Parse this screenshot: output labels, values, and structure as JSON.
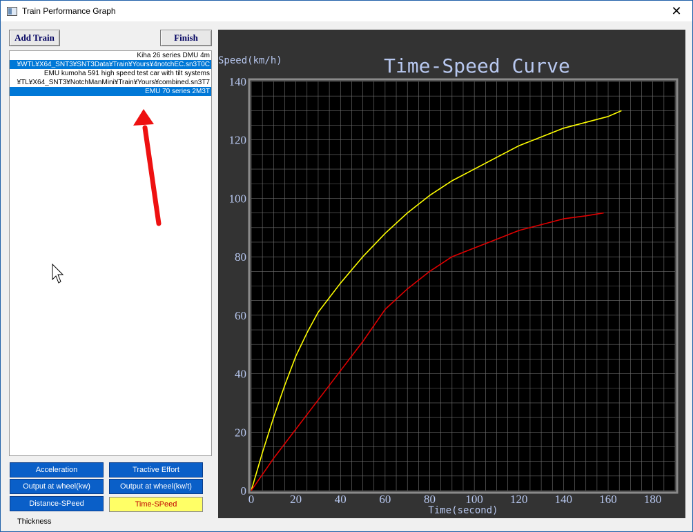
{
  "window": {
    "title": "Train Performance Graph",
    "close_symbol": "✕"
  },
  "toolbar": {
    "add_train": "Add Train",
    "finish": "Finish"
  },
  "train_list": [
    {
      "label": "Kiha 26 series DMU 4m",
      "selected": false
    },
    {
      "label": "¥WTL¥X64_SNT3¥SNT3Data¥Train¥Yours¥4notchEC.sn3T0C",
      "selected": true
    },
    {
      "label": "EMU kumoha 591 high speed test car with tilt systems",
      "selected": false
    },
    {
      "label": "¥TL¥X64_SNT3¥NotchManMini¥Train¥Yours¥combined.sn3T7",
      "selected": false
    },
    {
      "label": "EMU 70 series  2M3T",
      "selected": true
    }
  ],
  "graph_buttons": {
    "acceleration": "Acceleration",
    "tractive_effort": "Tractive Effort",
    "output_kw": "Output at wheel(kw)",
    "output_kwt": "Output at wheel(kw/t)",
    "distance_speed": "Distance-SPeed",
    "time_speed": "Time-SPeed"
  },
  "thickness_label": "Thickness",
  "colors": {
    "panel_bg": "#333333",
    "plot_bg": "#000000",
    "grid": "#6e6e6e",
    "axis_text": "#b8c8f0",
    "series1": "#ffff00",
    "series2": "#e00000",
    "selection": "#0078d7"
  },
  "icons": {
    "close": "close-icon",
    "app": "app-icon",
    "cursor": "mouse-pointer-icon",
    "annotation": "red-arrow-annotation"
  },
  "chart_data": {
    "type": "line",
    "title": "Time-Speed Curve",
    "ylabel": "Speed(km/h)",
    "xlabel": "Time(second)",
    "xlim": [
      0,
      190
    ],
    "ylim": [
      0,
      140
    ],
    "xticks": [
      0,
      20,
      40,
      60,
      80,
      100,
      120,
      140,
      160,
      180
    ],
    "yticks": [
      0,
      20,
      40,
      60,
      80,
      100,
      120,
      140
    ],
    "grid": true,
    "series": [
      {
        "color": "#ffff00",
        "x": [
          0,
          5,
          10,
          15,
          20,
          25,
          30,
          40,
          50,
          60,
          70,
          80,
          90,
          100,
          110,
          120,
          130,
          140,
          150,
          160,
          166
        ],
        "y": [
          0,
          13,
          25,
          36,
          46,
          54,
          61,
          71,
          80,
          88,
          95,
          101,
          106,
          110,
          114,
          118,
          121,
          124,
          126,
          128,
          130
        ]
      },
      {
        "color": "#e00000",
        "x": [
          0,
          10,
          20,
          30,
          40,
          50,
          60,
          70,
          80,
          90,
          100,
          110,
          120,
          130,
          140,
          150,
          158
        ],
        "y": [
          0,
          11,
          21,
          31,
          41,
          51,
          62,
          69,
          75,
          80,
          83,
          86,
          89,
          91,
          93,
          94,
          95
        ]
      }
    ]
  }
}
